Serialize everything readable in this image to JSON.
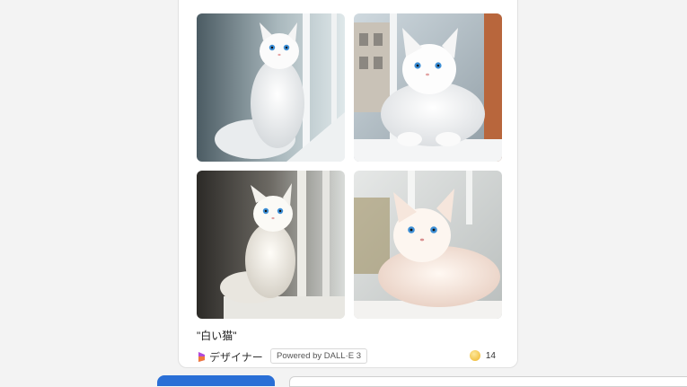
{
  "result": {
    "prompt_text": "\"白い猫\"",
    "images": [
      {
        "alt": "white cat by window 1"
      },
      {
        "alt": "white cat by window 2"
      },
      {
        "alt": "white cat by window 3"
      },
      {
        "alt": "white cat by window 4"
      }
    ],
    "designer_label": "デザイナー",
    "powered_by_label": "Powered by DALL·E 3",
    "boost_count": "14"
  },
  "colors": {
    "accent_blue": "#2a6fd6",
    "coin_gold": "#f3c44a",
    "cat_eye_blue": "#3d8fd6"
  }
}
